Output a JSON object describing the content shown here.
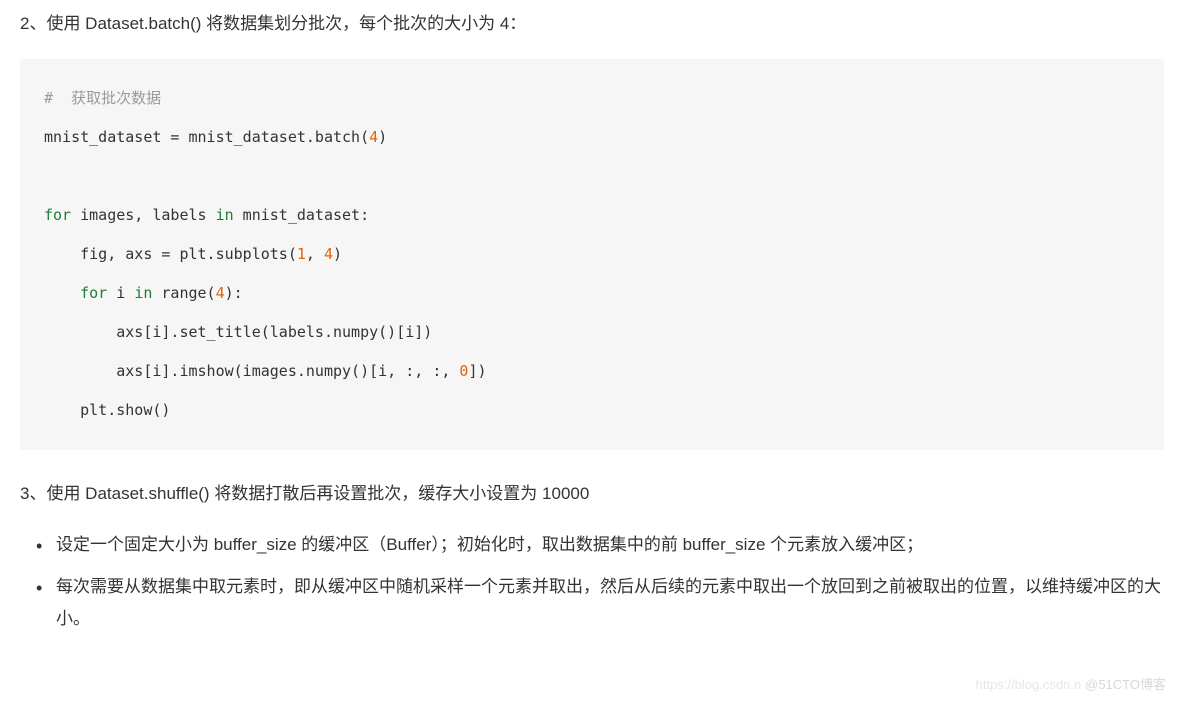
{
  "section2": {
    "heading": "2、使用 Dataset.batch() 将数据集划分批次，每个批次的大小为 4："
  },
  "code": {
    "comment": "#  获取批次数据",
    "line1_a": "mnist_dataset = mnist_dataset.batch(",
    "line1_num": "4",
    "line1_b": ")",
    "line2_for": "for",
    "line2_a": " images, labels ",
    "line2_in": "in",
    "line2_b": " mnist_dataset:",
    "line3_a": "    fig, axs = plt.subplots(",
    "line3_n1": "1",
    "line3_c": ", ",
    "line3_n2": "4",
    "line3_b": ")",
    "line4_for": "for",
    "line4_a": " i ",
    "line4_in": "in",
    "line4_b": " range(",
    "line4_n": "4",
    "line4_c": "):",
    "line5": "        axs[i].set_title(labels.numpy()[i])",
    "line6_a": "        axs[i].imshow(images.numpy()[i, :, :, ",
    "line6_n": "0",
    "line6_b": "])",
    "line7": "    plt.show()"
  },
  "section3": {
    "heading": "3、使用 Dataset.shuffle() 将数据打散后再设置批次，缓存大小设置为 10000",
    "bullets": [
      "设定一个固定大小为 buffer_size 的缓冲区（Buffer）；初始化时，取出数据集中的前 buffer_size 个元素放入缓冲区；",
      "每次需要从数据集中取元素时，即从缓冲区中随机采样一个元素并取出，然后从后续的元素中取出一个放回到之前被取出的位置，以维持缓冲区的大小。"
    ]
  },
  "watermark": {
    "left": "https://blog.csdn.n",
    "right": "@51CTO博客"
  }
}
